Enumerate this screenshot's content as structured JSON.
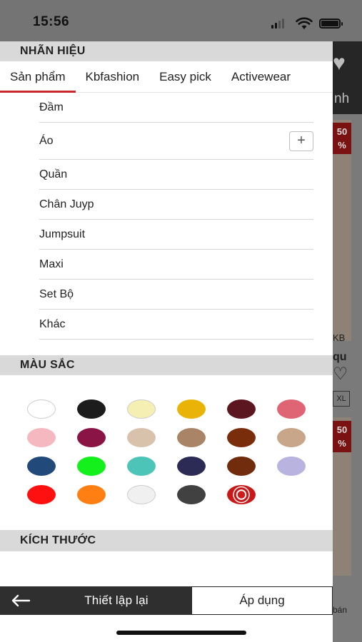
{
  "status_bar": {
    "time": "15:56"
  },
  "background_page": {
    "header_text": "nh",
    "badges": [
      {
        "line1": "50",
        "line2": "%"
      },
      {
        "line1": "50",
        "line2": "%"
      }
    ],
    "product_text": "KB",
    "product_title": "qu",
    "size_tag": "XL",
    "footer_text": "bán"
  },
  "filter": {
    "brand_header": "NHÃN HIỆU",
    "tabs": [
      {
        "label": "Sản phẩm",
        "active": true
      },
      {
        "label": "Kbfashion",
        "active": false
      },
      {
        "label": "Easy pick",
        "active": false
      },
      {
        "label": "Activewear",
        "active": false
      }
    ],
    "categories": [
      {
        "label": "Đầm"
      },
      {
        "label": "Áo",
        "expandable": true
      },
      {
        "label": "Quần"
      },
      {
        "label": "Chân Juyp"
      },
      {
        "label": "Jumpsuit"
      },
      {
        "label": "Maxi"
      },
      {
        "label": "Set Bộ"
      },
      {
        "label": "Khác"
      }
    ],
    "color_header": "MÀU SẮC",
    "colors": [
      "#ffffff",
      "#1c1c1c",
      "#f6efb4",
      "#e9b308",
      "#5c1620",
      "#df6575",
      "#f6b8c0",
      "#8a1445",
      "#d8c2ac",
      "#a98466",
      "#7a2d0b",
      "#c7a68a",
      "#21497a",
      "#14f01b",
      "#4dc4b8",
      "#2b2b56",
      "#702c0d",
      "#b8b3df",
      "#ff1010",
      "#ff7f12",
      "#f0f0f0",
      "#414141",
      "pattern"
    ],
    "size_header": "KÍCH THƯỚC"
  },
  "bottom_bar": {
    "reset_label": "Thiết lập lại",
    "apply_label": "Áp dụng"
  }
}
